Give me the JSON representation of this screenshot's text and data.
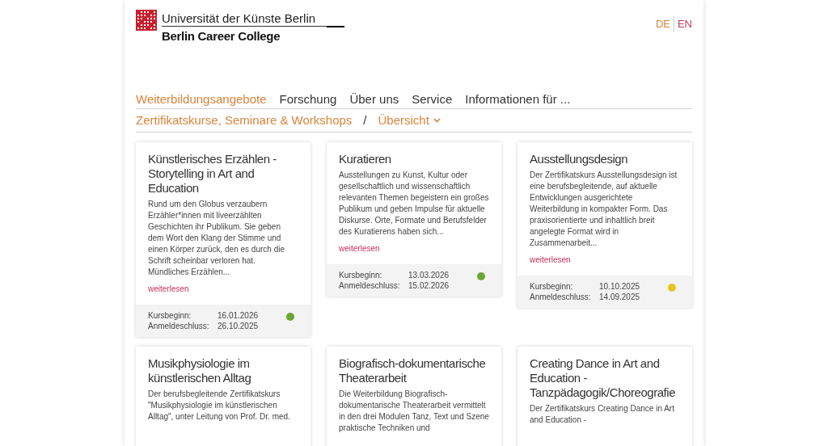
{
  "header": {
    "university": "Universität der Künste Berlin",
    "college": "Berlin Career College"
  },
  "languages": [
    {
      "label": "DE",
      "selected": true
    },
    {
      "label": "EN",
      "selected": false
    }
  ],
  "nav": [
    {
      "label": "Weiterbildungsangebote",
      "selected": true
    },
    {
      "label": "Forschung",
      "selected": false
    },
    {
      "label": "Über uns",
      "selected": false
    },
    {
      "label": "Service",
      "selected": false
    },
    {
      "label": "Informationen für ...",
      "selected": false
    }
  ],
  "breadcrumb": {
    "section": "Zertifikatskurse, Seminare & Workshops",
    "separator": "/",
    "current": "Übersicht"
  },
  "cards": [
    {
      "title": "Künstlerisches Erzählen - Storytelling in Art and Education",
      "text": "Rund um den Globus verzaubern Erzähler*innen mit liveerzählten Geschichten ihr Publikum. Sie geben dem Wort den Klang der Stimme und einen Körper zurück, den es durch die Schrift scheinbar verloren hat. Mündliches Erzählen...",
      "link": "weiterlesen",
      "start_label": "Kursbeginn:",
      "start": "16.01.2026",
      "deadline_label": "Anmeldeschluss:",
      "deadline": "26.10.2025",
      "color": "#6aa632"
    },
    {
      "title": "Kuratieren",
      "text": "Ausstellungen zu Kunst, Kultur oder gesellschaftlich und wissenschaftlich relevanten Themen begeistern ein großes Publikum und geben Impulse für aktuelle Diskurse. Orte, Formate und Berufsfelder des Kuratierens haben sich...",
      "link": "weiterlesen",
      "start_label": "Kursbeginn:",
      "start": "13.03.2026",
      "deadline_label": "Anmeldeschluss:",
      "deadline": "15.02.2026",
      "color": "#6aa632"
    },
    {
      "title": "Ausstellungsdesign",
      "text": "Der Zertifikatskurs Ausstellungsdesign ist eine berufsbegleitende, auf aktuelle Entwicklungen ausgerichtete Weiterbildung in kompakter Form. Das praxisorientierte und inhaltlich breit angelegte Format wird in Zusammenarbeit...",
      "link": "weiterlesen",
      "start_label": "Kursbeginn:",
      "start": "10.10.2025",
      "deadline_label": "Anmeldeschluss:",
      "deadline": "14.09.2025",
      "color": "#e8c41c"
    },
    {
      "title": "Musikphysiologie im künstlerischen Alltag",
      "text": "Der berufsbegleitende Zertifikatskurs \"Musikphysiologie im künstlerischen Alltag\", unter Leitung von Prof. Dr. med."
    },
    {
      "title": "Biografisch-dokumentarische Theaterarbeit",
      "text": "Die Weiterbildung Biografisch-dokumentarische Theaterarbeit vermittelt in den drei Modulen Tanz, Text und Szene praktische Techniken und"
    },
    {
      "title": "Creating Dance in Art and Education - Tanzpädagogik/Choreografie",
      "text": "Der Zertifikatskurs Creating Dance in Art and Education -"
    }
  ]
}
